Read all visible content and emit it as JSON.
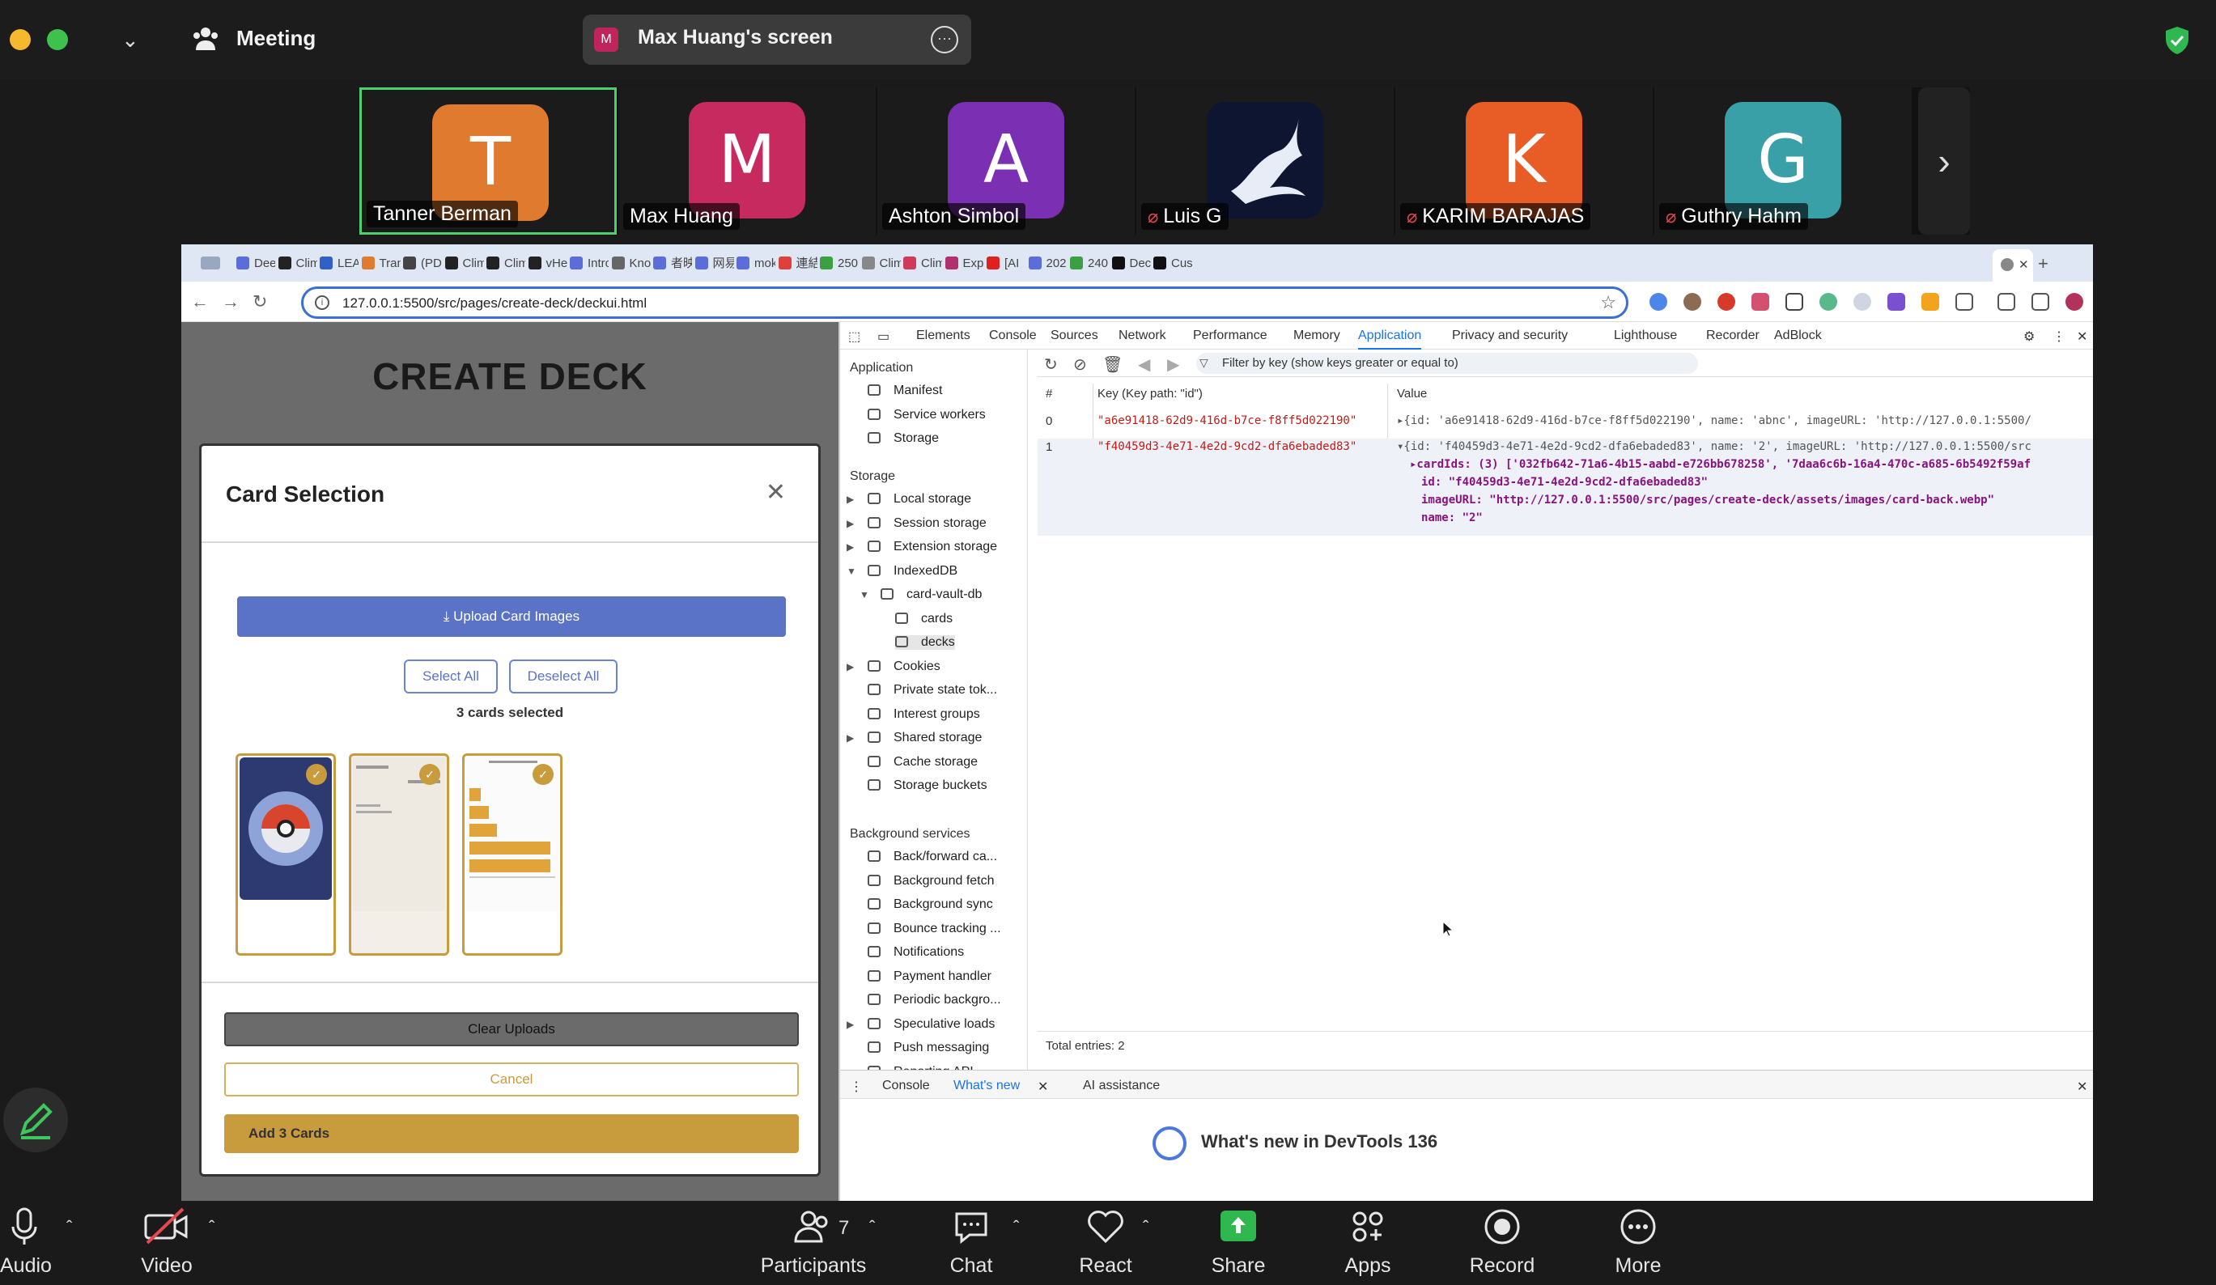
{
  "zoom": {
    "meeting_label": "Meeting",
    "screen_share_label": "Max Huang's screen",
    "screen_share_initial": "M",
    "participants": [
      {
        "initial": "T",
        "name": "Tanner Berman",
        "color": "#e07a2f",
        "muted": false,
        "active": true
      },
      {
        "initial": "M",
        "name": "Max Huang",
        "color": "#c72a5e",
        "muted": false,
        "active": false
      },
      {
        "initial": "A",
        "name": "Ashton Simbol",
        "color": "#7b2fb3",
        "muted": false,
        "active": false
      },
      {
        "initial": "",
        "name": "Luis G",
        "color": "#0d1530",
        "muted": true,
        "active": false
      },
      {
        "initial": "K",
        "name": "KARIM BARAJAS",
        "color": "#e85d26",
        "muted": true,
        "active": false
      },
      {
        "initial": "G",
        "name": "Guthry Hahm",
        "color": "#3aa0a8",
        "muted": true,
        "active": false
      }
    ],
    "controls": {
      "audio": "Audio",
      "video": "Video",
      "participants": "Participants",
      "participants_count": "7",
      "chat": "Chat",
      "react": "React",
      "share": "Share",
      "apps": "Apps",
      "record": "Record",
      "more": "More"
    }
  },
  "browser": {
    "tabs": [
      "Dee",
      "Clim",
      "LEA",
      "Tran",
      "(PD",
      "Clim",
      "Clim",
      "vHe",
      "Intro",
      "Kno",
      "者映",
      "网易",
      "mok",
      "連結",
      "250",
      "Clim",
      "Clim",
      "Expl",
      "[AI",
      "202",
      "240",
      "Dec",
      "Cus"
    ],
    "url": "127.0.0.1:5500/src/pages/create-deck/deckui.html"
  },
  "page": {
    "title": "CREATE DECK",
    "modal": {
      "title": "Card Selection",
      "close": "✕",
      "upload_label": "Upload Card Images",
      "select_all": "Select All",
      "deselect_all": "Deselect All",
      "selected_text": "3 cards selected",
      "clear_uploads": "Clear Uploads",
      "cancel": "Cancel",
      "add_cards": "Add  3  Cards"
    }
  },
  "devtools": {
    "tabs": [
      "Elements",
      "Console",
      "Sources",
      "Network",
      "Performance",
      "Memory",
      "Application",
      "Privacy and security",
      "Lighthouse",
      "Recorder",
      "AdBlock"
    ],
    "active_tab": "Application",
    "sidebar": {
      "application_header": "Application",
      "application_items": [
        "Manifest",
        "Service workers",
        "Storage"
      ],
      "storage_header": "Storage",
      "storage_items": [
        "Local storage",
        "Session storage",
        "Extension storage",
        "IndexedDB",
        "card-vault-db",
        "cards",
        "decks",
        "Cookies",
        "Private state tok...",
        "Interest groups",
        "Shared storage",
        "Cache storage",
        "Storage buckets"
      ],
      "background_header": "Background services",
      "background_items": [
        "Back/forward ca...",
        "Background fetch",
        "Background sync",
        "Bounce tracking ...",
        "Notifications",
        "Payment handler",
        "Periodic backgro...",
        "Speculative loads",
        "Push messaging",
        "Reporting API"
      ]
    },
    "filter_placeholder": "Filter by key (show keys greater or equal to)",
    "columns": {
      "index": "#",
      "key": "Key (Key path: \"id\")",
      "value": "Value"
    },
    "rows": [
      {
        "index": "0",
        "key": "\"a6e91418-62d9-416d-b7ce-f8ff5d022190\"",
        "value": "▸{id: 'a6e91418-62d9-416d-b7ce-f8ff5d022190', name: 'abnc', imageURL: 'http://127.0.0.1:5500/"
      },
      {
        "index": "1",
        "key": "\"f40459d3-4e71-4e2d-9cd2-dfa6ebaded83\"",
        "value": "▾{id: 'f40459d3-4e71-4e2d-9cd2-dfa6ebaded83', name: '2', imageURL: 'http://127.0.0.1:5500/src",
        "cardIds": "▸cardIds: (3) ['032fb642-71a6-4b15-aabd-e726bb678258', '7daa6c6b-16a4-470c-a685-6b5492f59af",
        "id": "id: \"f40459d3-4e71-4e2d-9cd2-dfa6ebaded83\"",
        "imageURL": "imageURL: \"http://127.0.0.1:5500/src/pages/create-deck/assets/images/card-back.webp\"",
        "name": "name: \"2\""
      }
    ],
    "total_entries": "Total entries: 2",
    "drawer_tabs": [
      "Console",
      "What's new",
      "AI assistance"
    ],
    "whats_new_title": "What's new in DevTools 136"
  }
}
